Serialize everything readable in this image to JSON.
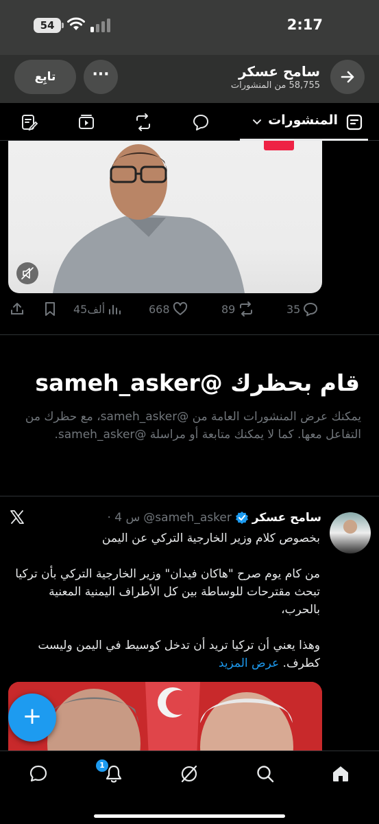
{
  "status_bar": {
    "time": "2:17",
    "battery": "54"
  },
  "header": {
    "name": "سامح عسكر",
    "post_count": "58,755 من المنشورات",
    "follow_label": "تابِع",
    "more_label": "···"
  },
  "tabs": {
    "active_label": "المنشورات"
  },
  "post_actions": {
    "views": "45ألف",
    "likes": "668",
    "reposts": "89",
    "replies": "35"
  },
  "blocked": {
    "title": "قام بحظرك @sameh_asker",
    "description": "يمكنك عرض المنشورات العامة من @sameh_asker، مع حظرك من التفاعل معها. كما لا يمكنك متابعة أو مراسلة @sameh_asker."
  },
  "tweet": {
    "name": "سامح عسكر",
    "handle": "@sameh_asker",
    "time": "· 4 س",
    "body": "بخصوص كلام وزير الخارجية التركي عن اليمن\n\nمن كام يوم صرح \"هاكان فيدان\"  وزير الخارجية التركي بأن تركيا تبحث مقترحات للوساطة بين كل الأطراف اليمنية المعنية بالحرب،\n\nوهذا يعني أن تركيا تريد أن تدخل كوسيط في اليمن وليست كطرف. ",
    "show_more": "عرض المزيد"
  },
  "fab": {
    "label": "+"
  },
  "nav": {
    "notif_count": "1"
  },
  "colors": {
    "accent": "#1d9bf0",
    "background": "#000000",
    "muted": "#71767b"
  }
}
